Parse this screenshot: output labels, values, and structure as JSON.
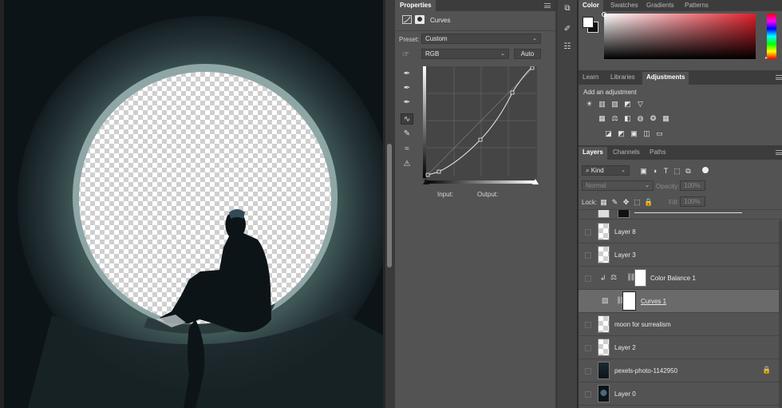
{
  "properties": {
    "title": "Properties",
    "adjustment_name": "Curves",
    "preset_label": "Preset:",
    "preset_value": "Custom",
    "channel_value": "RGB",
    "auto_label": "Auto",
    "input_label": "Input:",
    "output_label": "Output:"
  },
  "color_panel": {
    "tabs": [
      "Color",
      "Swatches",
      "Gradients",
      "Patterns"
    ]
  },
  "adjust_panel": {
    "tabs": [
      "Learn",
      "Libraries",
      "Adjustments"
    ],
    "add_label": "Add an adjustment"
  },
  "layers_panel": {
    "tabs": [
      "Layers",
      "Channels",
      "Paths"
    ],
    "kind_label": "Kind",
    "blend_mode": "Normal",
    "opacity_label": "Opacity:",
    "opacity_value": "100%",
    "lock_label": "Lock:",
    "fill_label": "Fill:",
    "fill_value": "100%",
    "layers": [
      {
        "name": "Layer 8"
      },
      {
        "name": "Layer 3"
      },
      {
        "name": "Color Balance 1"
      },
      {
        "name": "Curves 1"
      },
      {
        "name": "moon for surrealism"
      },
      {
        "name": "Layer 2"
      },
      {
        "name": "pexels-photo-1142950"
      },
      {
        "name": "Layer 0"
      }
    ]
  },
  "colors": {
    "panel_bg": "#535353",
    "header_bg": "#3c3c3c",
    "selected_row": "#6a6a6a",
    "accent_red": "#e0202a"
  }
}
